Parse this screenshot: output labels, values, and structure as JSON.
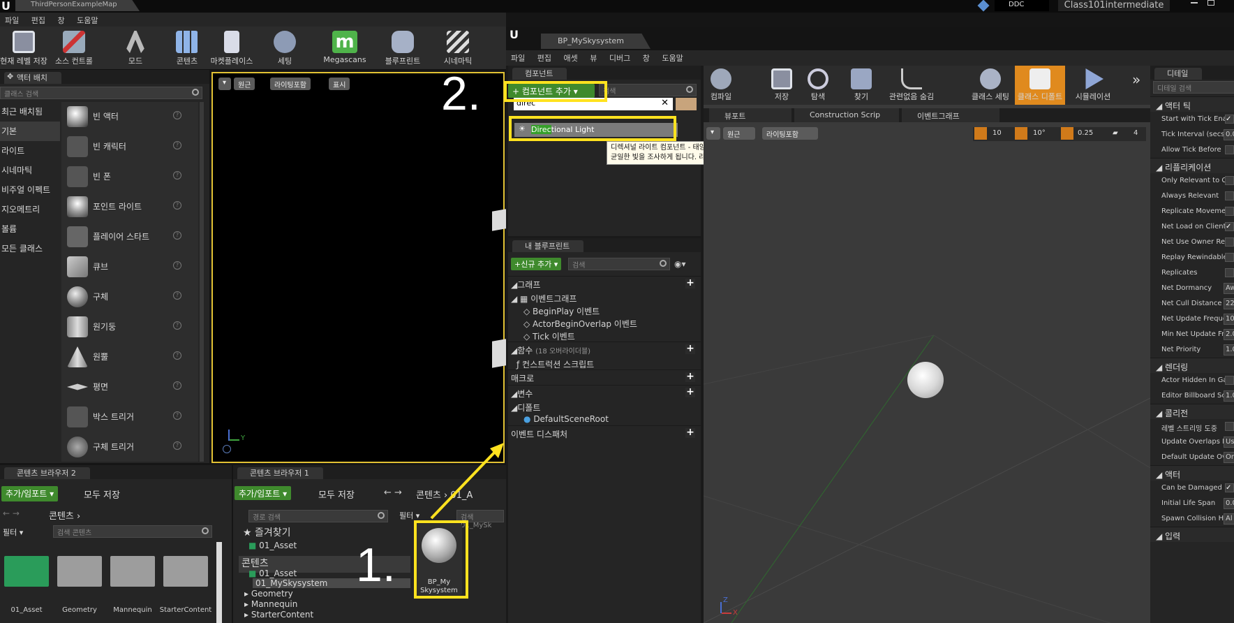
{
  "app": {
    "logo": "U",
    "map_tab": "ThirdPersonExampleMap",
    "ddc": "DDC",
    "project": "Class101intermediate"
  },
  "main_menu": [
    "파일",
    "편집",
    "창",
    "도움말"
  ],
  "main_toolbar": [
    {
      "label": "현재 레벨 저장",
      "icon": "save-icon"
    },
    {
      "label": "소스 컨트롤",
      "icon": "source-control-icon"
    },
    {
      "label": "모드",
      "icon": "modes-icon"
    },
    {
      "label": "콘텐츠",
      "icon": "content-icon"
    },
    {
      "label": "마켓플레이스",
      "icon": "marketplace-icon"
    },
    {
      "label": "세팅",
      "icon": "settings-icon"
    },
    {
      "label": "Megascans",
      "icon": "megascans-icon"
    },
    {
      "label": "블루프린트",
      "icon": "blueprint-icon"
    },
    {
      "label": "시네마틱",
      "icon": "cinematic-icon"
    }
  ],
  "place_actors": {
    "tab": "액터 배치",
    "search_placeholder": "클래스 검색",
    "categories": [
      "최근 배치됨",
      "기본",
      "라이트",
      "시네마틱",
      "비주얼 이펙트",
      "지오메트리",
      "볼륨",
      "모든 클래스"
    ],
    "items": [
      "빈 액터",
      "빈 캐릭터",
      "빈 폰",
      "포인트 라이트",
      "플레이어 스타트",
      "큐브",
      "구체",
      "원기둥",
      "원뿔",
      "평면",
      "박스 트리거",
      "구체 트리거"
    ]
  },
  "viewport": {
    "perspective": "원근",
    "lit": "라이팅포함",
    "show": "표시",
    "axis_y": "Y"
  },
  "content_browser_2": {
    "tab": "콘텐츠 브라우저 2",
    "add_import": "추가/임포트",
    "save_all": "모두 저장",
    "path": "콘텐츠",
    "filter": "필터",
    "search_placeholder": "검색 콘텐츠",
    "folders": [
      "01_Asset",
      "Geometry",
      "Mannequin",
      "StarterContent"
    ]
  },
  "content_browser_1": {
    "tab": "콘텐츠 브라우저 1",
    "add_import": "추가/임포트",
    "save_all": "모두 저장",
    "path_root": "콘텐츠",
    "path_current": "01_A",
    "path_search_placeholder": "경로 검색",
    "filter": "필터",
    "asset_search_placeholder": "검색 01_MySk",
    "favorites": "즐겨찾기",
    "fav_folder": "01_Asset",
    "content_root": "콘텐츠",
    "tree": [
      "01_Asset",
      "01_MySkysystem",
      "Geometry",
      "Mannequin",
      "StarterContent"
    ],
    "asset_name": "BP_My Skysystem"
  },
  "blueprint_editor": {
    "logo": "U",
    "tab": "BP_MySkysystem",
    "menu": [
      "파일",
      "편집",
      "애셋",
      "뷰",
      "디버그",
      "창",
      "도움말"
    ],
    "components": {
      "tab": "컴포넌트",
      "add_component": "컴포넌트 추가",
      "search_placeholder": "검색",
      "search_value": "direc",
      "result_highlight": "Direc",
      "result_rest": "tional Light",
      "tooltip": "디렉셔널 라이트 컴포넌트 - 태양과 같이 평행한 빛을 발산하는 라이트 컴포넌트입니다. 영향받는 모든 표면에 균일한 빛을 조사하게 됩니다. 라이트매스 임포턴스 볼륨 안의 모든 물체에 영향을 주게 됩니다."
    },
    "my_blueprint": {
      "tab": "내 블루프린트",
      "add_new": "신규 추가",
      "search_placeholder": "검색",
      "graphs": "그래프",
      "event_graph": "이벤트그래프",
      "events": [
        "BeginPlay 이벤트",
        "ActorBeginOverlap 이벤트",
        "Tick 이벤트"
      ],
      "functions": "함수",
      "functions_note": "(18 오버라이더블)",
      "construction_script": "컨스트럭션 스크립트",
      "macros": "매크로",
      "variables": "변수",
      "components": "디폴트",
      "default_root": "DefaultSceneRoot",
      "dispatchers": "이벤트 디스패처"
    },
    "toolbar": [
      {
        "label": "컴파일",
        "icon": "compile-icon"
      },
      {
        "label": "저장",
        "icon": "save-icon"
      },
      {
        "label": "탐색",
        "icon": "browse-icon"
      },
      {
        "label": "찾기",
        "icon": "find-icon"
      },
      {
        "label": "관련없음 숨김",
        "icon": "hide-unrelated-icon"
      },
      {
        "label": "클래스 세팅",
        "icon": "class-settings-icon"
      },
      {
        "label": "클래스 디폴트",
        "icon": "class-defaults-icon"
      },
      {
        "label": "시뮬레이션",
        "icon": "simulation-icon"
      }
    ],
    "viewport_tabs": [
      "뷰포트",
      "Construction Scrip",
      "이벤트그래프"
    ],
    "viewport_controls": {
      "perspective": "원근",
      "lit": "라이팅포함",
      "grid": "10",
      "rot": "10°",
      "scale": "0.25",
      "cam": "4",
      "axis_z": "Z",
      "axis_x": "X"
    }
  },
  "details": {
    "tab": "디테일",
    "search_placeholder": "디테일 검색",
    "sections": [
      {
        "title": "액터 틱",
        "rows": [
          "Start with Tick Ena",
          "Tick Interval (secs",
          "Allow Tick Before"
        ]
      },
      {
        "title": "리플리케이션",
        "rows": [
          "Only Relevant to C",
          "Always Relevant",
          "Replicate Moveme",
          "Net Load on Client",
          "Net Use Owner Re",
          "Replay Rewindable",
          "Replicates",
          "Net Dormancy",
          "Net Cull Distance",
          "Net Update Freque",
          "Min Net Update Fr",
          "Net Priority"
        ]
      },
      {
        "title": "렌더링",
        "rows": [
          "Actor Hidden In Ga",
          "Editor Billboard Sc"
        ]
      },
      {
        "title": "콜리전",
        "rows": [
          "레벨 스트리밍 도중",
          "Update Overlaps M",
          "Default Update Ov"
        ]
      },
      {
        "title": "액터",
        "rows": [
          "Can be Damaged",
          "Initial Life Span",
          "Spawn Collision H"
        ]
      },
      {
        "title": "입력",
        "rows": []
      }
    ],
    "values": {
      "tick_interval": "0.0",
      "net_dormancy": "Aw",
      "net_cull": "22",
      "net_update": "10",
      "min_net": "2.0",
      "net_priority": "1.0",
      "billboard": "1.0",
      "update_overlaps": "Us",
      "default_update": "On",
      "life_span": "0.0",
      "spawn_collision": "Al"
    }
  },
  "annotations": {
    "step1": "1.",
    "step2": "2."
  }
}
